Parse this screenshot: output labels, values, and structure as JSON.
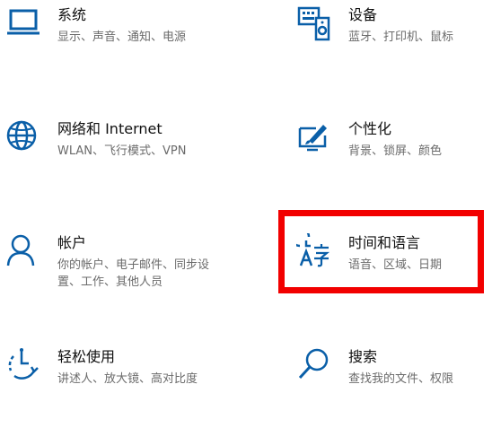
{
  "accent_color": "#0a5fa8",
  "highlight_color": "#f20000",
  "tiles": {
    "system": {
      "title": "系统",
      "desc": "显示、声音、通知、电源",
      "icon": "laptop-icon"
    },
    "devices": {
      "title": "设备",
      "desc": "蓝牙、打印机、鼠标",
      "icon": "keyboard-speaker-icon"
    },
    "network": {
      "title": "网络和 Internet",
      "desc": "WLAN、飞行模式、VPN",
      "icon": "globe-icon"
    },
    "personalization": {
      "title": "个性化",
      "desc": "背景、锁屏、颜色",
      "icon": "paintbrush-monitor-icon"
    },
    "accounts": {
      "title": "帐户",
      "desc": "你的帐户、电子邮件、同步设置、工作、其他人员",
      "icon": "person-icon"
    },
    "time_language": {
      "title": "时间和语言",
      "desc": "语音、区域、日期",
      "icon": "clock-language-icon"
    },
    "ease_of_access": {
      "title": "轻松使用",
      "desc": "讲述人、放大镜、高对比度",
      "icon": "ease-of-access-icon"
    },
    "search": {
      "title": "搜索",
      "desc": "查找我的文件、权限",
      "icon": "search-icon"
    }
  }
}
